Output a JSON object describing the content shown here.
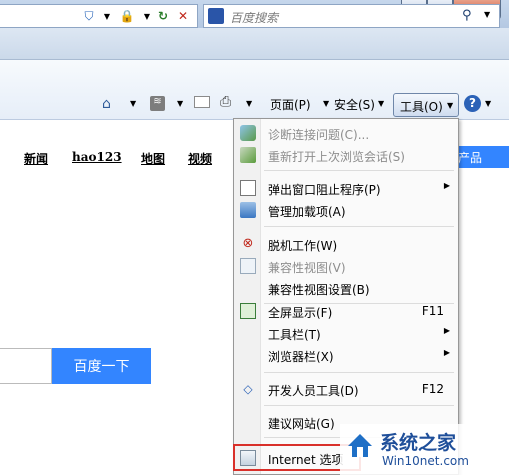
{
  "colors": {
    "accent": "#3385ff",
    "highlight": "#d9302a"
  },
  "search": {
    "placeholder": "百度搜索"
  },
  "commandbar": {
    "page": "页面(P)",
    "safety": "安全(S)",
    "tools": "工具(O)"
  },
  "page": {
    "nav_links": [
      "新闻",
      "hao123",
      "地图",
      "视频"
    ],
    "products_tab": "产品",
    "search_button": "百度一下"
  },
  "menu": {
    "items": [
      {
        "label": "诊断连接问题(C)...",
        "disabled": true,
        "icon": "diagnose-icon"
      },
      {
        "label": "重新打开上次浏览会话(S)",
        "disabled": true,
        "icon": "reopen-icon"
      },
      {
        "label": "弹出窗口阻止程序(P)",
        "submenu": true,
        "icon": "popup-blocker-icon"
      },
      {
        "label": "管理加载项(A)",
        "icon": "addons-icon"
      },
      {
        "label": "脱机工作(W)",
        "icon": "offline-icon"
      },
      {
        "label": "兼容性视图(V)",
        "disabled": true,
        "icon": "compat-view-icon"
      },
      {
        "label": "兼容性视图设置(B)"
      },
      {
        "label": "全屏显示(F)",
        "shortcut": "F11",
        "icon": "fullscreen-icon"
      },
      {
        "label": "工具栏(T)",
        "submenu": true
      },
      {
        "label": "浏览器栏(X)",
        "submenu": true
      },
      {
        "label": "开发人员工具(D)",
        "shortcut": "F12",
        "icon": "devtools-icon"
      },
      {
        "label": "建议网站(G)"
      },
      {
        "label": "Internet 选项",
        "icon": "internet-options-icon"
      }
    ]
  },
  "watermark": {
    "title": "系统之家",
    "url": "Win10net.com"
  }
}
